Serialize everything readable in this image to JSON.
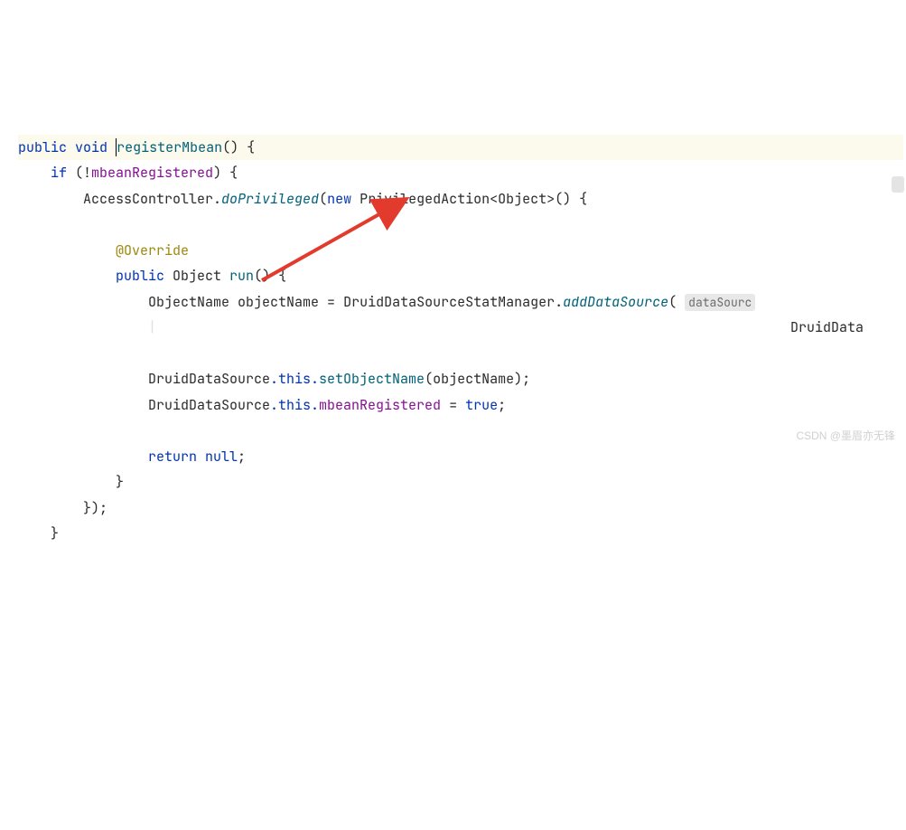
{
  "code": {
    "l1_public": "public",
    "l1_void": "void",
    "l1_fn": "registerMbean",
    "l1_rest": "() {",
    "l2_if": "if",
    "l2_not": " (!",
    "l2_field": "mbeanRegistered",
    "l2_rest": ") {",
    "l3_cls": "AccessController",
    "l3_dot": ".",
    "l3_fn": "doPrivileged",
    "l3_open": "(",
    "l3_new": "new",
    "l3_type": " PrivilegedAction",
    "l3_gen": "<Object>() {",
    "l5_anno": "@Override",
    "l6_public": "public",
    "l6_obj": " Object ",
    "l6_fn": "run",
    "l6_rest": "() {",
    "l7_type": "ObjectName ",
    "l7_var": "objectName",
    "l7_eq": " = ",
    "l7_cls": "DruidDataSourceStatManager",
    "l7_dot": ".",
    "l7_fn": "addDataSource",
    "l7_open": "(",
    "l7_hint": "dataSourc",
    "l8_tail": "DruidData",
    "l10_cls": "DruidDataSource",
    "l10_this": ".this.",
    "l10_fn": "setObjectName",
    "l10_arg": "(objectName);",
    "l11_cls": "DruidDataSource",
    "l11_this": ".this.",
    "l11_field": "mbeanRegistered",
    "l11_eq": " = ",
    "l11_true": "true",
    "l11_semi": ";",
    "l13_return": "return",
    "l13_null": " null",
    "l13_semi": ";",
    "l14_brace": "}",
    "l15_close": "});",
    "l16_brace": "}"
  },
  "watermark": "CSDN @墨眉亦无锋"
}
